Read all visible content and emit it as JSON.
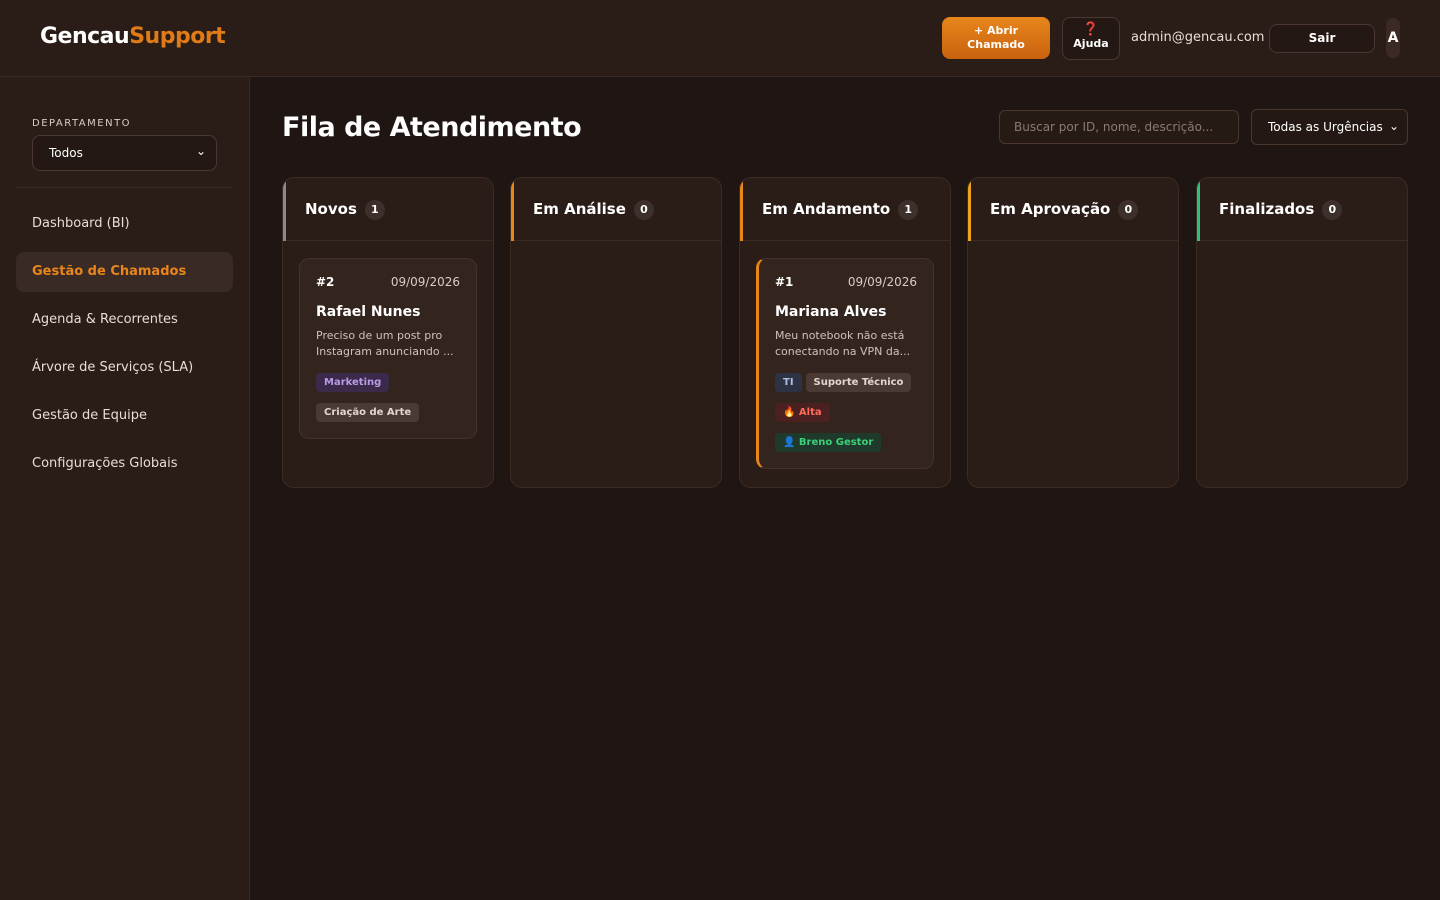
{
  "header": {
    "logo_part1": "Gencau",
    "logo_part2": "Support",
    "open_ticket_line1": "+ Abrir",
    "open_ticket_line2": "Chamado",
    "help_icon": "question-mark",
    "help_label": "Ajuda",
    "user_email": "admin@gencau.com",
    "logout_label": "Sair",
    "avatar_initial": "A"
  },
  "sidebar": {
    "department_label": "DEPARTAMENTO",
    "department_value": "Todos",
    "items": [
      {
        "label": "Dashboard (BI)"
      },
      {
        "label": "Gestão de Chamados",
        "active": true
      },
      {
        "label": "Agenda & Recorrentes"
      },
      {
        "label": "Árvore de Serviços (SLA)"
      },
      {
        "label": "Gestão de Equipe"
      },
      {
        "label": "Configurações Globais"
      }
    ]
  },
  "main": {
    "title": "Fila de Atendimento",
    "search_placeholder": "Buscar por ID, nome, descrição...",
    "urgency_filter": "Todas as Urgências",
    "columns": [
      {
        "title": "Novos",
        "count": "1",
        "color": "#8a8a8a"
      },
      {
        "title": "Em Análise",
        "count": "0",
        "color": "#e8861c"
      },
      {
        "title": "Em Andamento",
        "count": "1",
        "color": "#e8861c"
      },
      {
        "title": "Em Aprovação",
        "count": "0",
        "color": "#f0a21c"
      },
      {
        "title": "Finalizados",
        "count": "0",
        "color": "#2ec27e"
      }
    ],
    "cards": {
      "novos": {
        "id": "#2",
        "date": "09/09/2026",
        "name": "Rafael Nunes",
        "desc_line1": "Preciso de um post pro",
        "desc_line2": "Instagram anunciando ...",
        "tag_department": "Marketing",
        "tag_service": "Criação de Arte"
      },
      "andamento": {
        "id": "#1",
        "date": "09/09/2026",
        "name": "Mariana Alves",
        "desc_line1": "Meu notebook não está",
        "desc_line2": "conectando na VPN da...",
        "tag_department": "TI",
        "tag_service": "Suporte Técnico",
        "tag_urgency": "🔥 Alta",
        "tag_assignee": "👤 Breno Gestor"
      }
    }
  },
  "colors": {
    "accent": "#e8861c",
    "background": "#1f1512",
    "panel": "#2a1c17"
  }
}
